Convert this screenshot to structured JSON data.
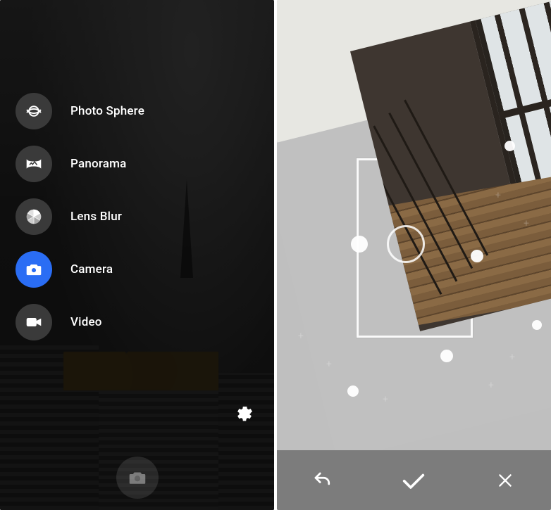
{
  "menu": {
    "items": [
      {
        "label": "Photo Sphere",
        "icon": "photo-sphere-icon",
        "active": false
      },
      {
        "label": "Panorama",
        "icon": "panorama-icon",
        "active": false
      },
      {
        "label": "Lens Blur",
        "icon": "lens-blur-icon",
        "active": false
      },
      {
        "label": "Camera",
        "icon": "camera-icon",
        "active": true
      },
      {
        "label": "Video",
        "icon": "video-icon",
        "active": false
      }
    ],
    "active_index": 3
  },
  "settings_icon": "gear-icon",
  "colors": {
    "accent": "#2a6df4",
    "dark_overlay": "rgba(0,0,0,0.55)",
    "action_bar": "#7c7c7c"
  },
  "capture_actions": {
    "undo": "undo-icon",
    "confirm": "check-icon",
    "cancel": "close-icon"
  }
}
